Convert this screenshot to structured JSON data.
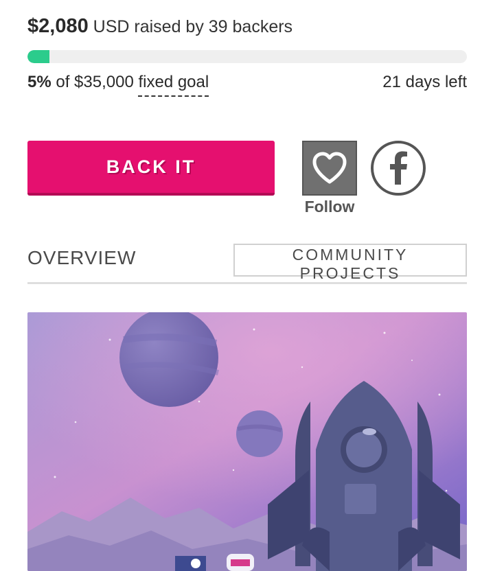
{
  "funding": {
    "amount": "$2,080",
    "raised_text": " USD raised by 39 backers",
    "progress_percent": 5,
    "percent_label": "5%",
    "goal_prefix": " of $35,000 ",
    "goal_type": "fixed goal",
    "days_left": "21 days left"
  },
  "actions": {
    "back_label": "BACK IT",
    "follow_label": "Follow"
  },
  "tabs": {
    "overview": "OVERVIEW",
    "community": "COMMUNITY PROJECTS"
  },
  "colors": {
    "accent": "#e5106f",
    "progress": "#2bcc8c"
  },
  "icons": [
    "heart-icon",
    "facebook-icon",
    "rocket-illustration"
  ]
}
